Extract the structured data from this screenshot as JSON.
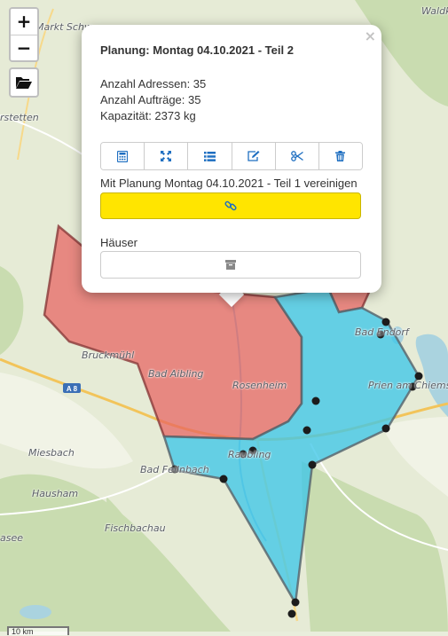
{
  "map": {
    "places": [
      {
        "name": "Markt Schw",
        "key": "markt_schw"
      },
      {
        "name": "Waldk",
        "key": "waldk"
      },
      {
        "name": "rstetten",
        "key": "rstetten"
      },
      {
        "name": "Bruckmühl",
        "key": "bruckmuehl"
      },
      {
        "name": "Bad Aibling",
        "key": "bad_aibling"
      },
      {
        "name": "Rosenheim",
        "key": "rosenheim"
      },
      {
        "name": "Bad Endorf",
        "key": "bad_endorf"
      },
      {
        "name": "Prien am Chiemse",
        "key": "prien"
      },
      {
        "name": "Miesbach",
        "key": "miesbach"
      },
      {
        "name": "Bad Feilnbach",
        "key": "bad_feilnbach"
      },
      {
        "name": "Raubling",
        "key": "raubling"
      },
      {
        "name": "Hausham",
        "key": "hausham"
      },
      {
        "name": "Fischbachau",
        "key": "fischbachau"
      },
      {
        "name": "asee",
        "key": "asee"
      }
    ],
    "road_badge": "A 8",
    "scale_text": "10 km",
    "zones": [
      {
        "name": "Planung Montag 04.10.2021 - Teil 1",
        "color": "#e8615f"
      },
      {
        "name": "Planung Montag 04.10.2021 - Teil 2",
        "color": "#3fc7e8"
      }
    ],
    "marker_color": "#1c1c1c"
  },
  "controls": {
    "zoom_in": "+",
    "zoom_out": "−",
    "open_icon": "folder-open-icon"
  },
  "popup": {
    "close": "×",
    "title": "Planung: Montag 04.10.2021 - Teil 2",
    "addresses": "Anzahl Adressen: 35",
    "orders": "Anzahl Aufträge: 35",
    "capacity": "Kapazität: 2373 kg",
    "toolbar": [
      {
        "icon": "calculator-icon"
      },
      {
        "icon": "expand-icon"
      },
      {
        "icon": "list-icon"
      },
      {
        "icon": "edit-icon"
      },
      {
        "icon": "scissors-icon"
      },
      {
        "icon": "trash-icon"
      }
    ],
    "merge_label": "Mit Planung Montag 04.10.2021 - Teil 1 vereinigen",
    "merge_icon": "link-icon",
    "merge_color": "#ffe500",
    "houses_label": "Häuser",
    "houses_icon": "archive-icon",
    "accent_color": "#1f6fc1"
  }
}
